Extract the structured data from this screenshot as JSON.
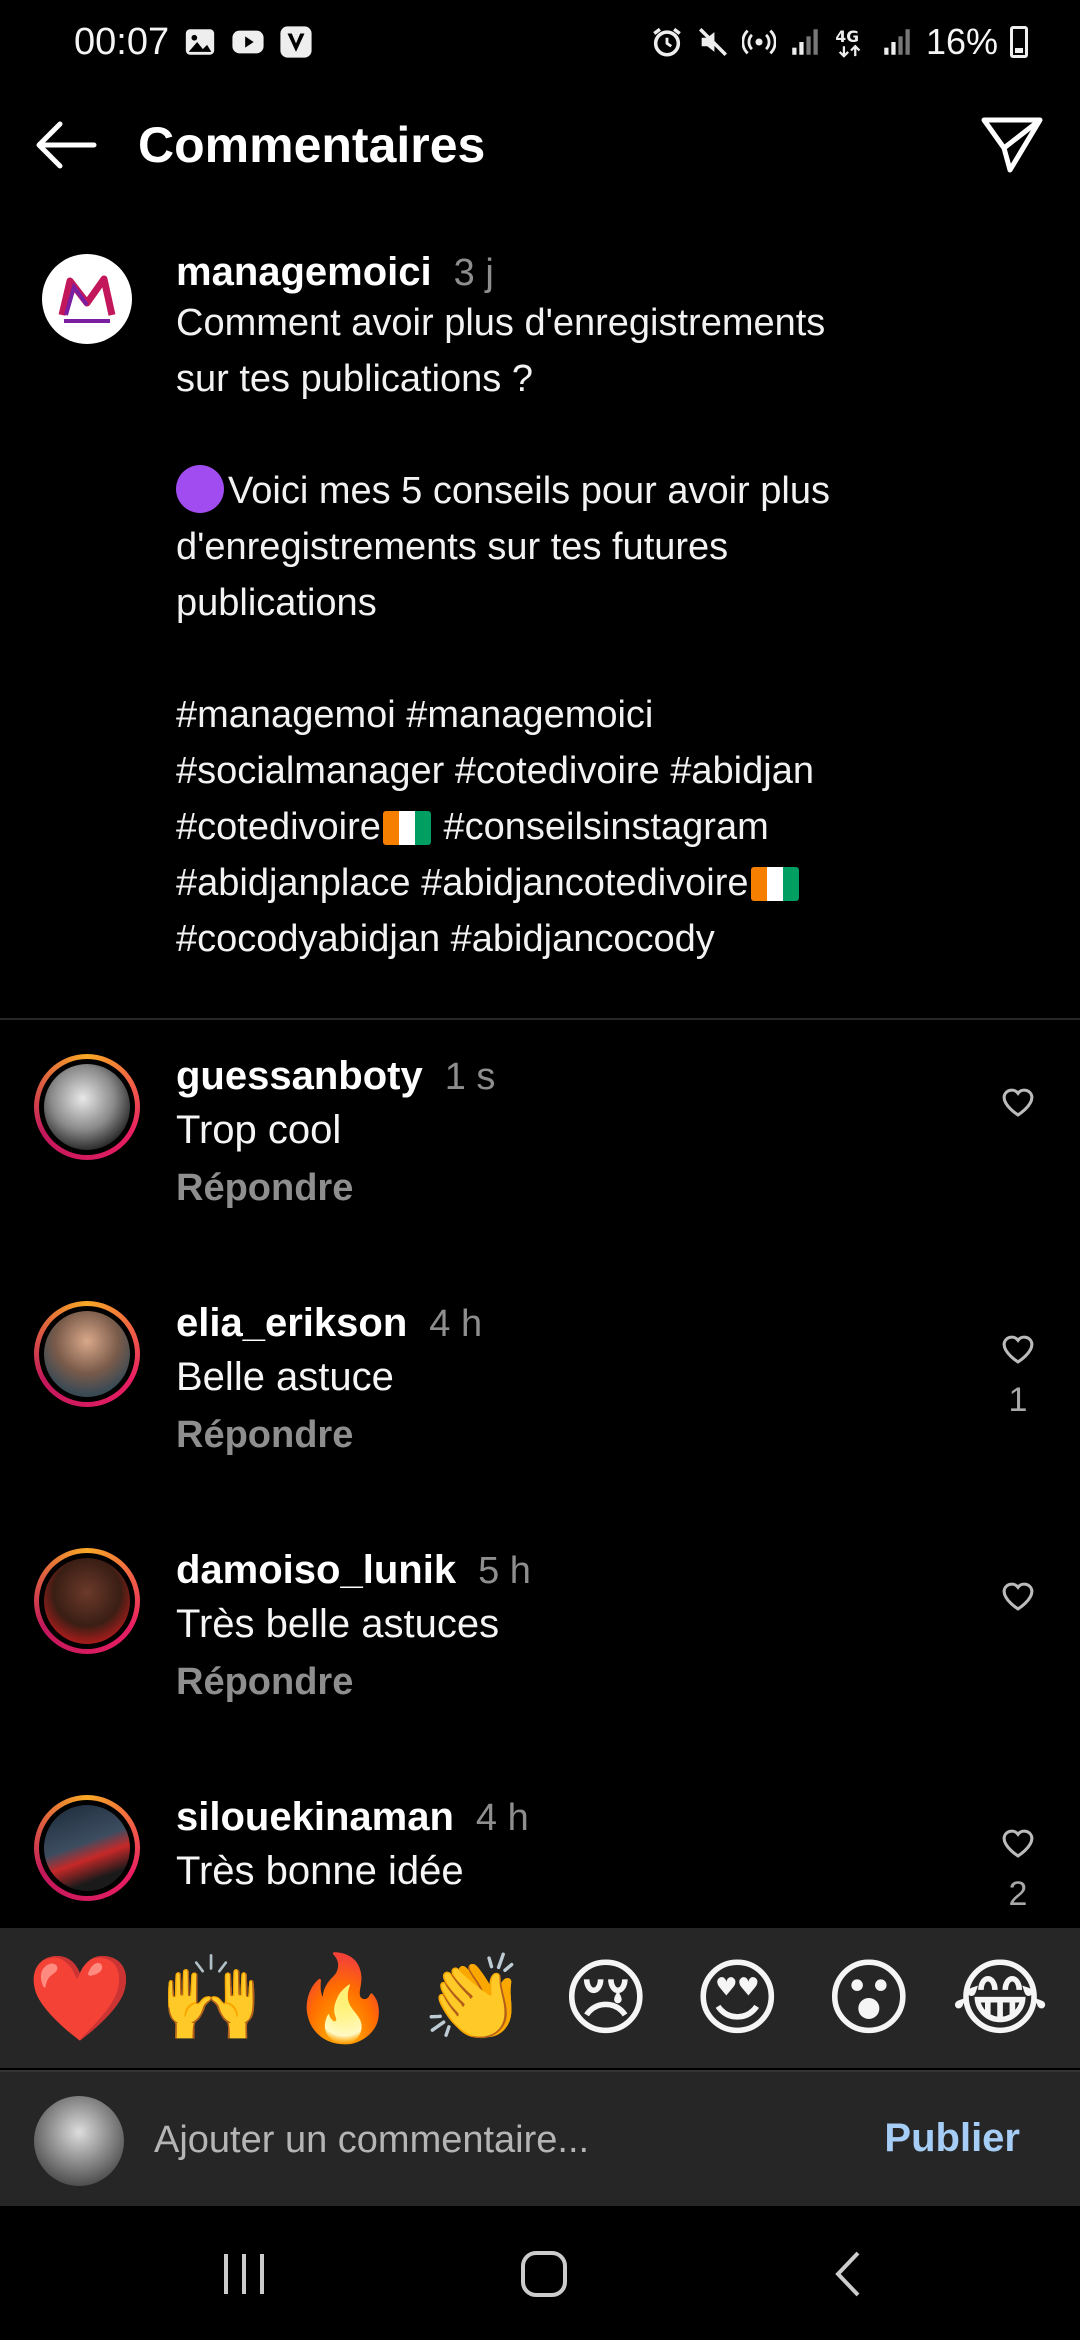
{
  "status_bar": {
    "time": "00:07",
    "battery": "16%",
    "icons_left": [
      "gallery-icon",
      "youtube-icon",
      "v-app-icon"
    ],
    "icons_right": [
      "alarm-icon",
      "mute-icon",
      "hotspot-icon",
      "signal-icon",
      "4g-icon",
      "signal-icon",
      "battery-icon"
    ]
  },
  "header": {
    "title": "Commentaires"
  },
  "caption": {
    "username": "managemoici",
    "time": "3 j",
    "line1": "Comment avoir plus d'enregistrements",
    "line2": "sur tes publications ?",
    "line3": "Voici mes 5 conseils pour avoir plus",
    "line4": "d'enregistrements sur tes futures",
    "line5": "publications",
    "tags1": "#managemoi #managemoici",
    "tags2": "#socialmanager #cotedivoire #abidjan",
    "tags3a": "#cotedivoire",
    "tags3b": " #conseilsinstagram",
    "tags4": "#abidjanplace #abidjancotedivoire",
    "tags5": "#cocodyabidjan #abidjancocody"
  },
  "comments": [
    {
      "username": "guessanboty",
      "time": "1 s",
      "text": "Trop cool",
      "reply": "Répondre",
      "likes": ""
    },
    {
      "username": "elia_erikson",
      "time": "4 h",
      "text": "Belle astuce",
      "reply": "Répondre",
      "likes": "1"
    },
    {
      "username": "damoiso_lunik",
      "time": "5 h",
      "text": "Très belle astuces",
      "reply": "Répondre",
      "likes": ""
    },
    {
      "username": "silouekinaman",
      "time": "4 h",
      "text": "Très bonne idée",
      "reply": "",
      "likes": "2"
    }
  ],
  "emoji_bar": [
    "❤️",
    "🙌",
    "🔥",
    "👏",
    "😢",
    "😍",
    "😮",
    "😂"
  ],
  "input": {
    "placeholder": "Ajouter un commentaire...",
    "publish_label": "Publier"
  },
  "colors": {
    "background": "#000000",
    "panel": "#262626",
    "muted": "#8e8e8e",
    "publish": "#a5cdf5"
  }
}
